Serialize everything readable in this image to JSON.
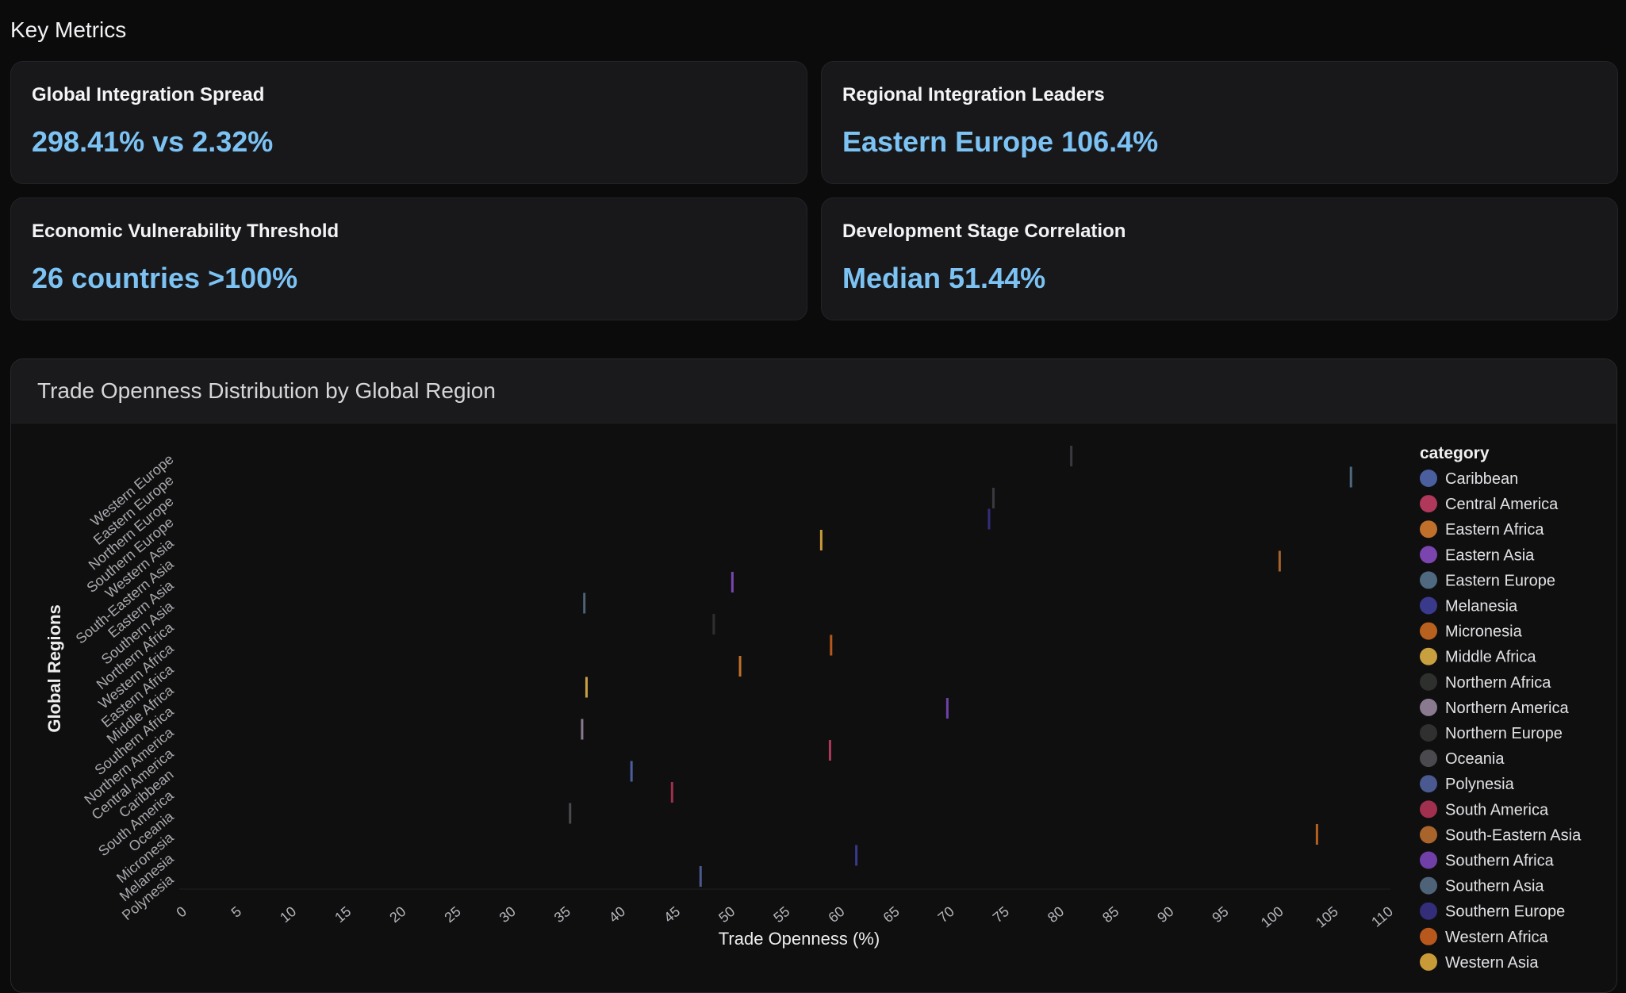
{
  "section": {
    "title": "Key Metrics"
  },
  "metrics": [
    {
      "label": "Global Integration Spread",
      "value": "298.41% vs 2.32%"
    },
    {
      "label": "Regional Integration Leaders",
      "value": "Eastern Europe 106.4%"
    },
    {
      "label": "Economic Vulnerability Threshold",
      "value": "26 countries >100%"
    },
    {
      "label": "Development Stage Correlation",
      "value": "Median 51.44%"
    }
  ],
  "chart": {
    "title": "Trade Openness Distribution by Global Region"
  },
  "chart_data": {
    "type": "scatter",
    "xlabel": "Trade Openness (%)",
    "ylabel": "Global Regions",
    "xlim": [
      0,
      110
    ],
    "xticks": [
      0,
      5,
      10,
      15,
      20,
      25,
      30,
      35,
      40,
      45,
      50,
      55,
      60,
      65,
      70,
      75,
      80,
      85,
      90,
      95,
      100,
      105,
      110
    ],
    "legend_title": "category",
    "legend_position": "right",
    "categories": [
      "Western Europe",
      "Eastern Europe",
      "Northern Europe",
      "Southern Europe",
      "Western Asia",
      "South-Eastern Asia",
      "Eastern Asia",
      "Southern Asia",
      "Northern Africa",
      "Western Africa",
      "Eastern Africa",
      "Middle Africa",
      "Southern Africa",
      "Northern America",
      "Central America",
      "Caribbean",
      "South America",
      "Oceania",
      "Micronesia",
      "Melanesia",
      "Polynesia"
    ],
    "legend": [
      {
        "name": "Caribbean",
        "color": "#4b5f9e"
      },
      {
        "name": "Central America",
        "color": "#b0385a"
      },
      {
        "name": "Eastern Africa",
        "color": "#c0702a"
      },
      {
        "name": "Eastern Asia",
        "color": "#7b45b0"
      },
      {
        "name": "Eastern Europe",
        "color": "#4f6a80"
      },
      {
        "name": "Melanesia",
        "color": "#3a3a8c"
      },
      {
        "name": "Micronesia",
        "color": "#b8611f"
      },
      {
        "name": "Middle Africa",
        "color": "#c8a040"
      },
      {
        "name": "Northern Africa",
        "color": "#2e302e"
      },
      {
        "name": "Northern America",
        "color": "#8a7a90"
      },
      {
        "name": "Northern Europe",
        "color": "#2f302f"
      },
      {
        "name": "Oceania",
        "color": "#4a4a4e"
      },
      {
        "name": "Polynesia",
        "color": "#4a5a90"
      },
      {
        "name": "South America",
        "color": "#a0304e"
      },
      {
        "name": "South-Eastern Asia",
        "color": "#a8642a"
      },
      {
        "name": "Southern Africa",
        "color": "#7040a8"
      },
      {
        "name": "Southern Asia",
        "color": "#4e6278"
      },
      {
        "name": "Southern Europe",
        "color": "#332d7a"
      },
      {
        "name": "Western Africa",
        "color": "#b8581c"
      },
      {
        "name": "Western Asia",
        "color": "#c89a38"
      }
    ],
    "points": [
      {
        "category": "Western Europe",
        "x": 80.9,
        "color": "#3a3a3e"
      },
      {
        "category": "Eastern Europe",
        "x": 106.4,
        "color": "#4f6a80"
      },
      {
        "category": "Northern Europe",
        "x": 73.8,
        "color": "#3a3a3e"
      },
      {
        "category": "Southern Europe",
        "x": 73.4,
        "color": "#332d7a"
      },
      {
        "category": "Western Asia",
        "x": 58.1,
        "color": "#c89a38"
      },
      {
        "category": "South-Eastern Asia",
        "x": 99.9,
        "color": "#a8642a"
      },
      {
        "category": "Eastern Asia",
        "x": 50.0,
        "color": "#7b45b0"
      },
      {
        "category": "Southern Asia",
        "x": 36.5,
        "color": "#4e6278"
      },
      {
        "category": "Northern Africa",
        "x": 48.3,
        "color": "#2e302e"
      },
      {
        "category": "Western Africa",
        "x": 59.0,
        "color": "#b8581c"
      },
      {
        "category": "Eastern Africa",
        "x": 50.7,
        "color": "#c0702a"
      },
      {
        "category": "Middle Africa",
        "x": 36.7,
        "color": "#c8a040"
      },
      {
        "category": "Southern Africa",
        "x": 69.6,
        "color": "#7040a8"
      },
      {
        "category": "Northern America",
        "x": 36.3,
        "color": "#8a7a90"
      },
      {
        "category": "Central America",
        "x": 58.9,
        "color": "#b0385a"
      },
      {
        "category": "Caribbean",
        "x": 40.8,
        "color": "#4b5f9e"
      },
      {
        "category": "South America",
        "x": 44.5,
        "color": "#a0304e"
      },
      {
        "category": "Oceania",
        "x": 35.2,
        "color": "#4a4a4e"
      },
      {
        "category": "Micronesia",
        "x": 103.3,
        "color": "#b8611f"
      },
      {
        "category": "Melanesia",
        "x": 61.3,
        "color": "#3a3a8c"
      },
      {
        "category": "Polynesia",
        "x": 47.1,
        "color": "#4a5a90"
      }
    ]
  }
}
